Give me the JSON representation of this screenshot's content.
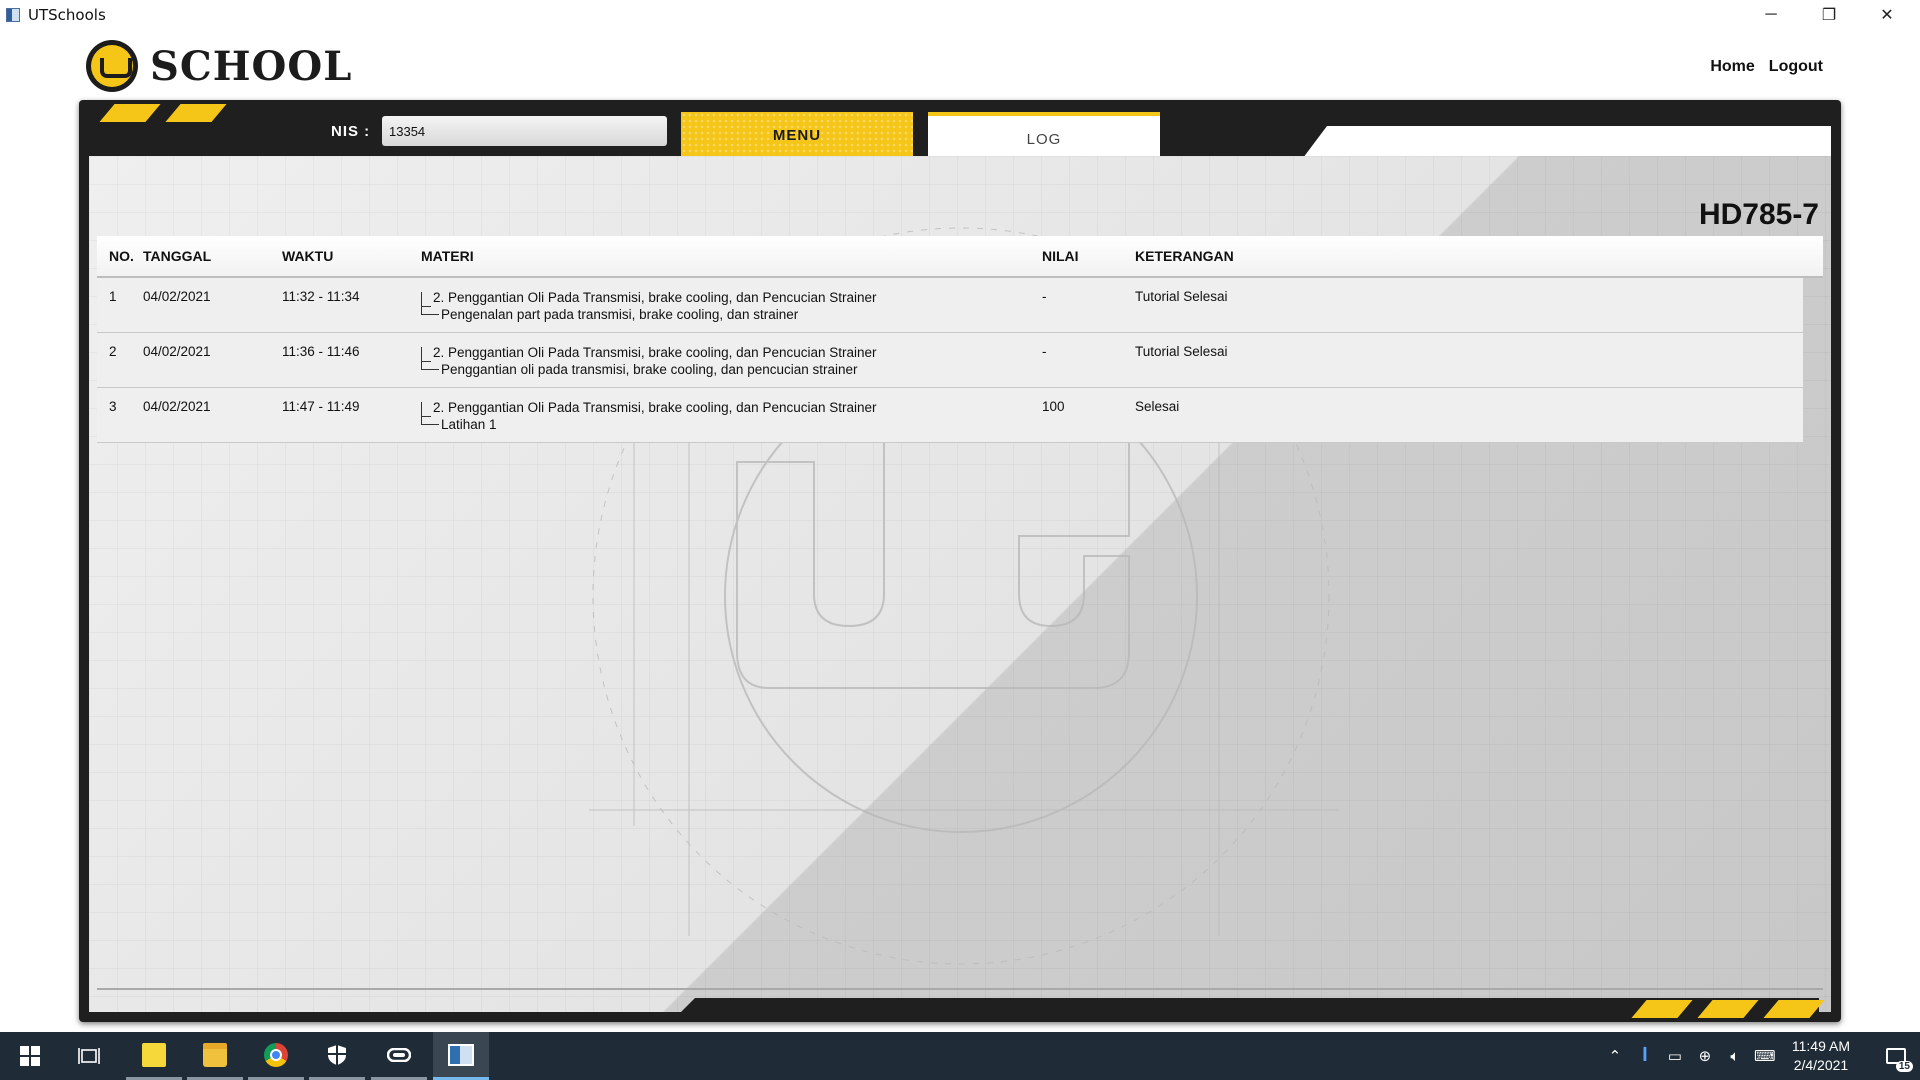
{
  "window": {
    "title": "UTSchools",
    "controls": {
      "minimize": "─",
      "maximize": "❐",
      "close": "✕"
    }
  },
  "header": {
    "logo_text": "SCHOOL",
    "nav": {
      "home": "Home",
      "logout": "Logout"
    }
  },
  "toolbar": {
    "nis_label": "NIS :",
    "nis_value": "13354",
    "tab_menu": "MENU",
    "tab_log": "LOG",
    "active_tab": "LOG"
  },
  "model_code": "HD785-7",
  "table": {
    "headers": {
      "no": "NO.",
      "tanggal": "TANGGAL",
      "waktu": "WAKTU",
      "materi": "MATERI",
      "nilai": "NILAI",
      "keterangan": "KETERANGAN"
    },
    "rows": [
      {
        "no": "1",
        "tanggal": "04/02/2021",
        "waktu": "11:32 - 11:34",
        "materi": "2. Penggantian Oli Pada Transmisi, brake cooling, dan Pencucian Strainer",
        "sub_materi": "Pengenalan part pada transmisi, brake cooling, dan strainer",
        "nilai": "-",
        "keterangan": "Tutorial Selesai"
      },
      {
        "no": "2",
        "tanggal": "04/02/2021",
        "waktu": "11:36 - 11:46",
        "materi": "2. Penggantian Oli Pada Transmisi, brake cooling, dan Pencucian Strainer",
        "sub_materi": "Penggantian oli pada transmisi, brake cooling, dan pencucian strainer",
        "nilai": "-",
        "keterangan": "Tutorial Selesai"
      },
      {
        "no": "3",
        "tanggal": "04/02/2021",
        "waktu": "11:47 - 11:49",
        "materi": "2. Penggantian Oli Pada Transmisi, brake cooling, dan Pencucian Strainer",
        "sub_materi": "Latihan 1",
        "nilai": "100",
        "keterangan": "Selesai"
      }
    ]
  },
  "taskbar": {
    "apps": [
      "windows-start-icon",
      "task-view-icon",
      "sticky-notes-icon",
      "file-explorer-icon",
      "chrome-icon",
      "windows-security-icon",
      "vpn-icon",
      "utschools-icon"
    ],
    "tray": {
      "time": "11:49 AM",
      "date": "2/4/2021",
      "notification_count": "15"
    }
  },
  "colors": {
    "accent_yellow": "#f5c518",
    "frame_dark": "#1f1f1f",
    "taskbar": "#1f2b36"
  }
}
